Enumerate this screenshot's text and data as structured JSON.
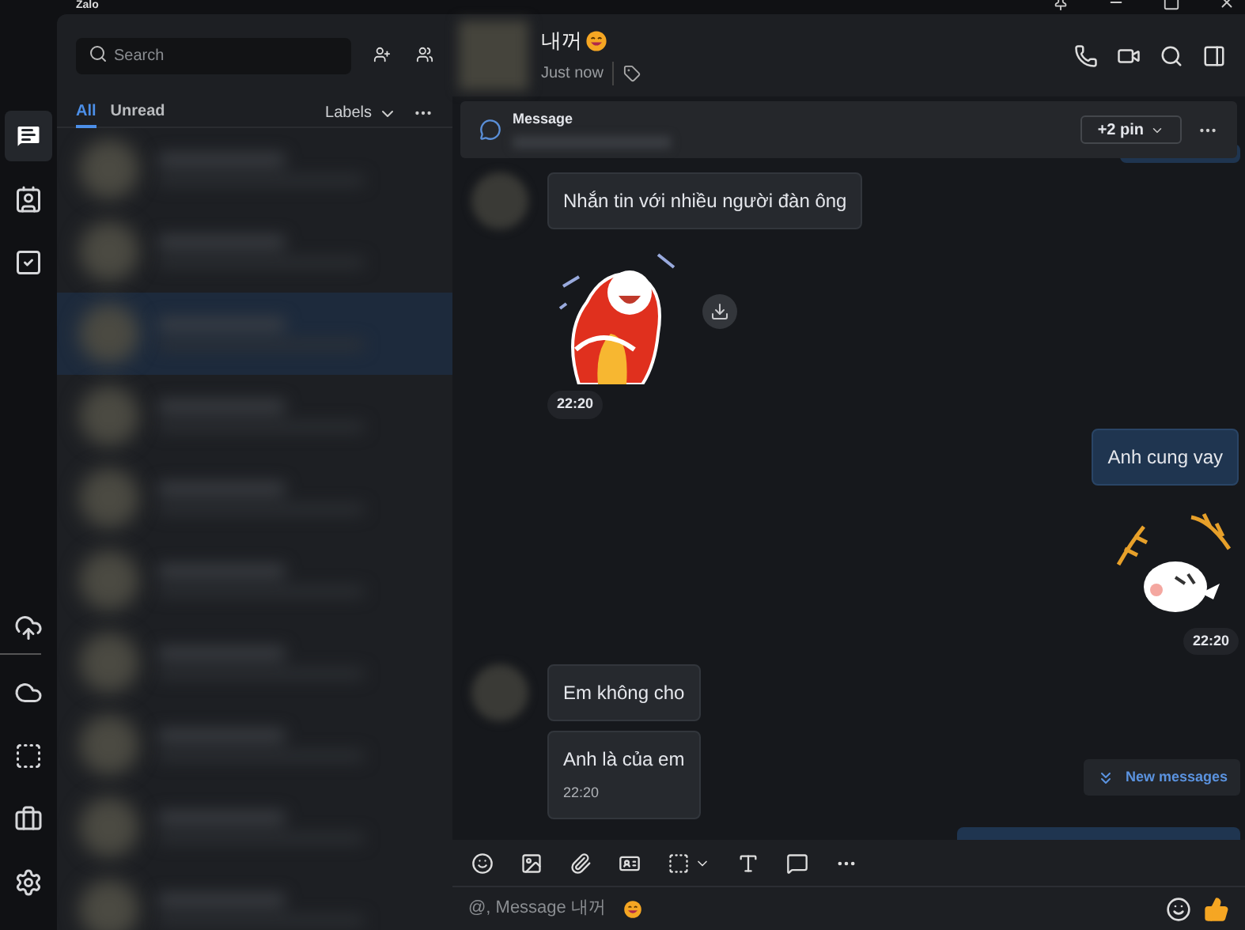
{
  "app": {
    "title": "Zalo"
  },
  "rail": {
    "items": [
      {
        "kind": "chat",
        "selected": true
      },
      {
        "kind": "contacts",
        "selected": false
      },
      {
        "kind": "todo",
        "selected": false
      },
      {
        "kind": "cloud-sync",
        "selected": false
      },
      {
        "kind": "cloud",
        "selected": false
      },
      {
        "kind": "capture",
        "selected": false
      },
      {
        "kind": "toolbox",
        "selected": false
      },
      {
        "kind": "settings",
        "selected": false
      }
    ]
  },
  "contacts_panel": {
    "search": {
      "placeholder": "Search"
    },
    "filters": [
      {
        "label": "All",
        "selected": true
      },
      {
        "label": "Unread",
        "selected": false
      }
    ],
    "labels_menu": "Labels",
    "conversations": [
      {
        "selected": false
      },
      {
        "selected": false
      },
      {
        "selected": true
      },
      {
        "selected": false
      },
      {
        "selected": false
      },
      {
        "selected": false
      },
      {
        "selected": false
      },
      {
        "selected": false
      },
      {
        "selected": false
      },
      {
        "selected": false
      }
    ]
  },
  "chat": {
    "header": {
      "name": "내꺼",
      "last_seen": "Just now"
    },
    "pinned": {
      "title": "Message",
      "more_pins": "+2 pin"
    },
    "messages": [
      {
        "kind": "text",
        "outgoing": false,
        "text": "Nhắn tin với nhiều người đàn ông"
      },
      {
        "kind": "sticker",
        "outgoing": false,
        "time": "22:20"
      },
      {
        "kind": "text",
        "outgoing": true,
        "text": "Anh cung vay"
      },
      {
        "kind": "sticker",
        "outgoing": true,
        "time": "22:20"
      },
      {
        "kind": "text",
        "outgoing": false,
        "text": "Em không cho"
      },
      {
        "kind": "text",
        "outgoing": false,
        "text": "Anh là của em",
        "time": "22:20"
      }
    ],
    "new_messages": "New messages",
    "composer": {
      "placeholder": "@, Message 내꺼"
    }
  }
}
